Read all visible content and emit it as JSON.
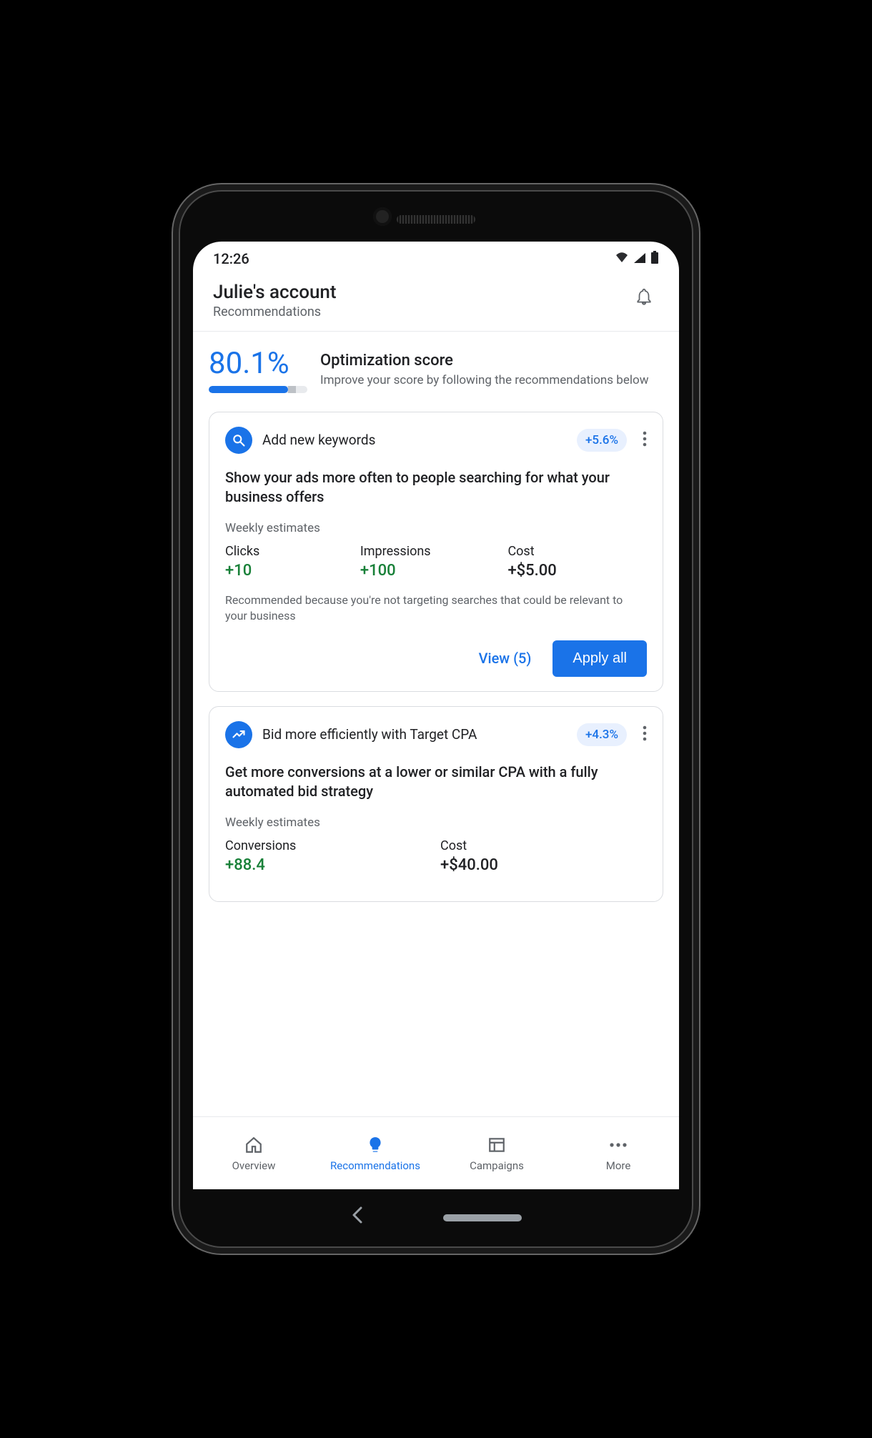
{
  "status": {
    "time": "12:26"
  },
  "header": {
    "title": "Julie's account",
    "subtitle": "Recommendations"
  },
  "optimization": {
    "percent": "80.1%",
    "title": "Optimization score",
    "description": "Improve your score by following the recommendations below",
    "fill_pct": 80.1
  },
  "cards": [
    {
      "icon": "search",
      "title": "Add new keywords",
      "gain": "+5.6%",
      "description": "Show your ads more often to people searching for what your business offers",
      "estimates_label": "Weekly estimates",
      "estimates": [
        {
          "name": "Clicks",
          "value": "+10",
          "color": "green"
        },
        {
          "name": "Impressions",
          "value": "+100",
          "color": "green"
        },
        {
          "name": "Cost",
          "value": "+$5.00",
          "color": "black"
        }
      ],
      "note": "Recommended because you're not targeting searches that could be relevant to your business",
      "view_label": "View (5)",
      "apply_label": "Apply all"
    },
    {
      "icon": "trend",
      "title": "Bid more efficiently with Target CPA",
      "gain": "+4.3%",
      "description": "Get more conversions at a lower or similar CPA with a fully automated bid strategy",
      "estimates_label": "Weekly estimates",
      "estimates": [
        {
          "name": "Conversions",
          "value": "+88.4",
          "color": "green"
        },
        {
          "name": "Cost",
          "value": "+$40.00",
          "color": "black"
        }
      ]
    }
  ],
  "nav": {
    "overview": "Overview",
    "recommendations": "Recommendations",
    "campaigns": "Campaigns",
    "more": "More"
  }
}
